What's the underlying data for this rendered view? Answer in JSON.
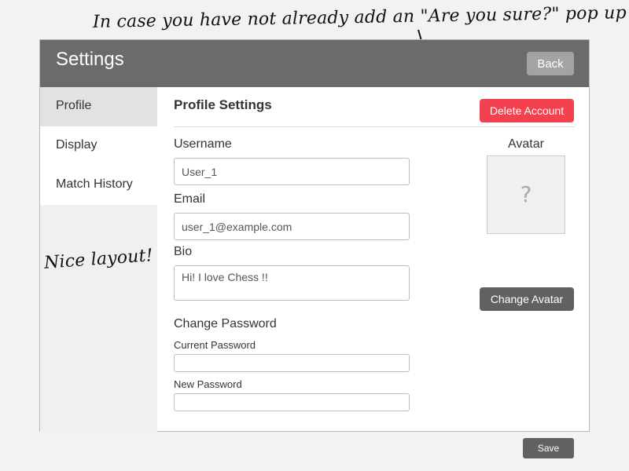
{
  "annotations": {
    "top": "In case you have not already add an \"Are you sure?\" pop up",
    "left": "Nice layout!"
  },
  "window": {
    "title": "Settings",
    "back_label": "Back"
  },
  "sidebar": {
    "items": [
      {
        "label": "Profile",
        "active": true
      },
      {
        "label": "Display",
        "active": false
      },
      {
        "label": "Match History",
        "active": false
      }
    ]
  },
  "profile": {
    "heading": "Profile Settings",
    "delete_label": "Delete Account",
    "username_label": "Username",
    "username_value": "User_1",
    "email_label": "Email",
    "email_value": "user_1@example.com",
    "bio_label": "Bio",
    "bio_value": "Hi! I love Chess !!",
    "avatar_label": "Avatar",
    "avatar_placeholder": "?",
    "change_avatar_label": "Change Avatar",
    "password_section_label": "Change Password",
    "current_password_label": "Current Password",
    "new_password_label": "New Password",
    "save_label": "Save"
  },
  "colors": {
    "titlebar": "#6b6b6b",
    "delete_button": "#f44150",
    "dark_button": "#616161",
    "active_sidebar": "#e2e2e2"
  }
}
